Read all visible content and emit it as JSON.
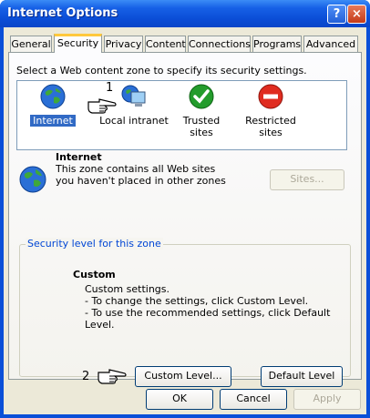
{
  "window": {
    "title": "Internet Options",
    "help_label": "?",
    "close_label": "×"
  },
  "tabs": [
    {
      "label": "General",
      "active": false
    },
    {
      "label": "Security",
      "active": true
    },
    {
      "label": "Privacy",
      "active": false
    },
    {
      "label": "Content",
      "active": false
    },
    {
      "label": "Connections",
      "active": false
    },
    {
      "label": "Programs",
      "active": false
    },
    {
      "label": "Advanced",
      "active": false
    }
  ],
  "security": {
    "zone_prompt": "Select a Web content zone to specify its security settings.",
    "zones": [
      {
        "label": "Internet",
        "icon": "globe-icon",
        "selected": true
      },
      {
        "label": "Local intranet",
        "icon": "computer-icon",
        "selected": false
      },
      {
        "label": "Trusted sites",
        "icon": "checkmark-icon",
        "selected": false
      },
      {
        "label": "Restricted sites",
        "icon": "no-entry-icon",
        "selected": false
      }
    ],
    "callout_1": "1",
    "callout_2": "2",
    "selected_zone": {
      "title": "Internet",
      "description": "This zone contains all Web sites you haven't placed in other zones",
      "sites_button": "Sites..."
    },
    "level_group": {
      "legend": "Security level for this zone",
      "level_title": "Custom",
      "lines": [
        "Custom settings.",
        "- To change the settings, click Custom Level.",
        "- To use the recommended settings, click Default Level."
      ],
      "custom_level_button": "Custom Level...",
      "default_level_button": "Default Level"
    }
  },
  "footer": {
    "ok": "OK",
    "cancel": "Cancel",
    "apply": "Apply"
  },
  "colors": {
    "titlebar": "#0a4fd8",
    "dialog_bg": "#ece9d8",
    "selection": "#316ac5",
    "group_legend": "#0046d5"
  }
}
